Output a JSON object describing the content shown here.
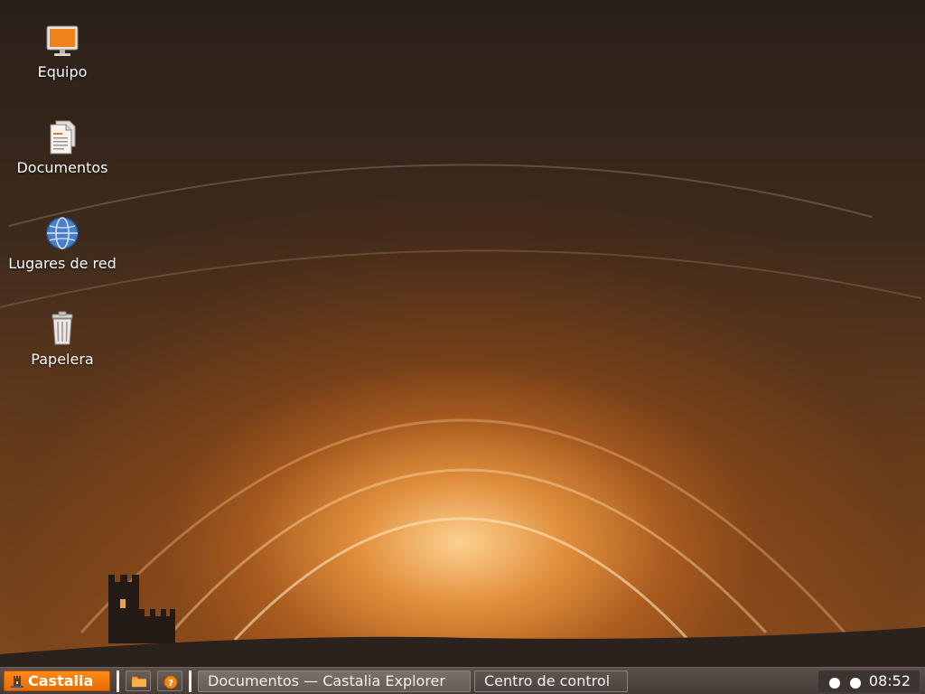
{
  "desktop": {
    "icons": [
      {
        "label": "Equipo",
        "icon": "computer-icon"
      },
      {
        "label": "Documentos",
        "icon": "documents-icon"
      },
      {
        "label": "Lugares de red",
        "icon": "network-globe-icon"
      },
      {
        "label": "Papelera",
        "icon": "trash-icon"
      }
    ]
  },
  "taskbar": {
    "start_label": "Castalia",
    "quick_launch": [
      {
        "icon": "folder-icon"
      },
      {
        "icon": "help-icon"
      }
    ],
    "tasks": [
      {
        "label": "Documentos — Castalia Explorer",
        "active": true
      },
      {
        "label": "Centro de control",
        "active": false
      }
    ],
    "tray": {
      "indicators": [
        "status-dot-icon",
        "status-dot-icon"
      ],
      "clock": "08:52"
    }
  },
  "colors": {
    "accent": "#ff8a1a",
    "taskbar": "#4e4540",
    "wallpaper_glow": "#f3a046"
  }
}
